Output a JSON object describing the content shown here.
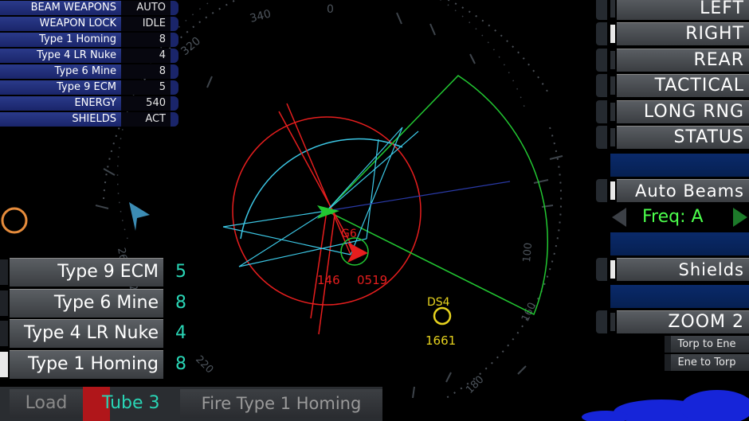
{
  "status_panel": [
    {
      "label": "BEAM WEAPONS",
      "value": "AUTO"
    },
    {
      "label": "WEAPON LOCK",
      "value": "IDLE"
    },
    {
      "label": "Type 1 Homing",
      "value": "8"
    },
    {
      "label": "Type 4 LR Nuke",
      "value": "4"
    },
    {
      "label": "Type 6 Mine",
      "value": "8"
    },
    {
      "label": "Type 9 ECM",
      "value": "5"
    },
    {
      "label": "ENERGY",
      "value": "540"
    },
    {
      "label": "SHIELDS",
      "value": "ACT"
    }
  ],
  "view_buttons": [
    {
      "label": "LEFT",
      "active": false
    },
    {
      "label": "RIGHT",
      "active": true
    },
    {
      "label": "REAR",
      "active": false
    },
    {
      "label": "TACTICAL",
      "active": false
    },
    {
      "label": "LONG RNG",
      "active": false
    },
    {
      "label": "STATUS",
      "active": false
    }
  ],
  "auto_beams_label": "Auto Beams",
  "freq_label": "Freq: A",
  "shields_label": "Shields",
  "zoom_label": "ZOOM 2",
  "torp_to_ene_label": "Torp to Ene",
  "ene_to_torp_label": "Ene to Torp",
  "weapons_list": [
    {
      "label": "Type 9 ECM",
      "count": "5"
    },
    {
      "label": "Type 6 Mine",
      "count": "8"
    },
    {
      "label": "Type 4 LR Nuke",
      "count": "4"
    },
    {
      "label": "Type 1 Homing",
      "count": "8"
    }
  ],
  "load_label": "Load",
  "tube_label": "Tube 3",
  "fire_label": "Fire Type 1 Homing",
  "radar": {
    "bearings": [
      "0",
      "340",
      "320",
      "260",
      "240",
      "220",
      "200",
      "180",
      "160",
      "120",
      "100"
    ],
    "enemy_label": "G6",
    "enemy_bearing": "146",
    "enemy_range": "0519",
    "station_label": "DS4",
    "station_range": "1661"
  },
  "colors": {
    "accent_cyan": "#29d5b5",
    "enemy_red": "#e61e1e",
    "ship_green": "#22c832",
    "station_yellow": "#e6d21e",
    "arc_cyan": "#3cc8e6"
  }
}
